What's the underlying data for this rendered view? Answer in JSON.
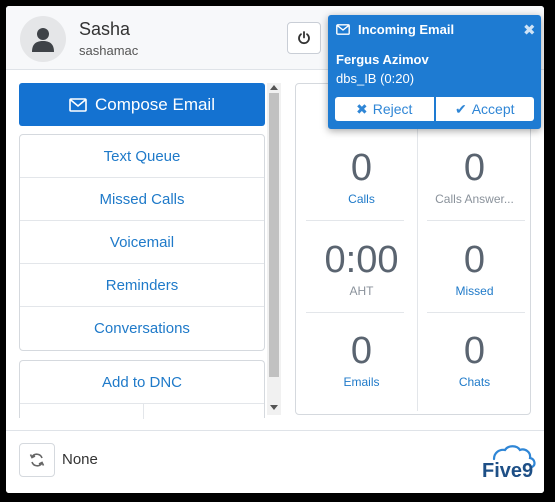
{
  "user": {
    "name": "Sasha",
    "handle": "sashamac"
  },
  "compose": {
    "label": "Compose Email"
  },
  "menu": {
    "items": [
      "Text Queue",
      "Missed Calls",
      "Voicemail",
      "Reminders",
      "Conversations"
    ],
    "dnc_label": "Add to DNC"
  },
  "stats": {
    "calls": {
      "value": "0",
      "label": "Calls"
    },
    "answered": {
      "value": "0",
      "label": "Calls Answer..."
    },
    "aht": {
      "value": "0:00",
      "label": "AHT"
    },
    "missed": {
      "value": "0",
      "label": "Missed"
    },
    "emails": {
      "value": "0",
      "label": "Emails"
    },
    "chats": {
      "value": "0",
      "label": "Chats"
    }
  },
  "footer": {
    "status": "None"
  },
  "brand": {
    "logo_text": "Five9"
  },
  "notification": {
    "title": "Incoming Email",
    "caller": "Fergus Azimov",
    "queue": "dbs_IB (0:20)",
    "reject_label": "Reject",
    "accept_label": "Accept"
  },
  "colors": {
    "primary": "#1472d1",
    "link": "#1f7ac9",
    "notification_bg": "#1e7bd2"
  }
}
